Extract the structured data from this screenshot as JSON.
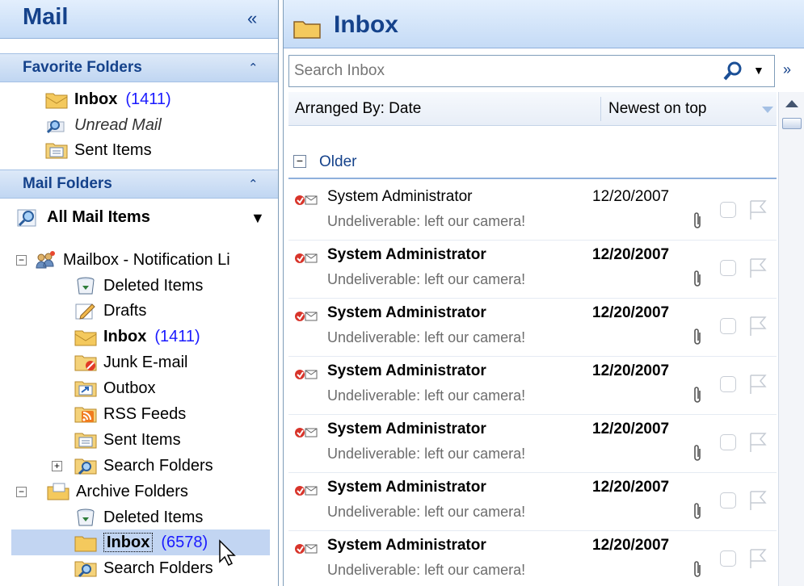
{
  "nav": {
    "title": "Mail",
    "collapse_glyph": "«",
    "favorites": {
      "header": "Favorite Folders",
      "collapse_glyph": "⌃",
      "items": [
        {
          "label": "Inbox",
          "count": "(1411)",
          "icon": "inbox-folder-icon"
        },
        {
          "label": "Unread Mail",
          "icon": "search-folder-icon"
        },
        {
          "label": "Sent Items",
          "icon": "sent-items-icon"
        }
      ]
    },
    "mail_folders": {
      "header": "Mail Folders",
      "collapse_glyph": "⌃",
      "all_items_label": "All Mail Items",
      "all_items_arrow": "▼",
      "mailbox": {
        "label": "Mailbox - Notification Li",
        "expander": "−",
        "children": [
          {
            "label": "Deleted Items",
            "icon": "deleted-items-icon"
          },
          {
            "label": "Drafts",
            "icon": "drafts-icon"
          },
          {
            "label": "Inbox",
            "count": "(1411)",
            "icon": "inbox-folder-icon"
          },
          {
            "label": "Junk E-mail",
            "icon": "junk-email-icon"
          },
          {
            "label": "Outbox",
            "icon": "outbox-icon"
          },
          {
            "label": "RSS Feeds",
            "icon": "rss-feeds-icon"
          },
          {
            "label": "Sent Items",
            "icon": "sent-items-icon"
          },
          {
            "label": "Search Folders",
            "icon": "search-folder-icon",
            "expander": "+"
          }
        ]
      },
      "archive": {
        "label": "Archive Folders",
        "expander": "−",
        "children": [
          {
            "label": "Deleted Items",
            "icon": "deleted-items-icon"
          },
          {
            "label": "Inbox",
            "count": "(6578)",
            "icon": "inbox-folder-icon",
            "selected": true
          },
          {
            "label": "Search Folders",
            "icon": "search-folder-icon"
          }
        ]
      }
    }
  },
  "main": {
    "title": "Inbox",
    "search_placeholder": "Search Inbox",
    "search_dropdown": "▼",
    "expand_glyph": "»",
    "arranged_by": "Arranged By: Date",
    "sort_order": "Newest on top",
    "group_expander": "−",
    "group_label": "Older",
    "messages": [
      {
        "from": "System Administrator",
        "date": "12/20/2007",
        "subject": "Undeliverable: left our camera!",
        "unread": false
      },
      {
        "from": "System Administrator",
        "date": "12/20/2007",
        "subject": "Undeliverable: left our camera!",
        "unread": true
      },
      {
        "from": "System Administrator",
        "date": "12/20/2007",
        "subject": "Undeliverable: left our camera!",
        "unread": true
      },
      {
        "from": "System Administrator",
        "date": "12/20/2007",
        "subject": "Undeliverable: left our camera!",
        "unread": true
      },
      {
        "from": "System Administrator",
        "date": "12/20/2007",
        "subject": "Undeliverable: left our camera!",
        "unread": true
      },
      {
        "from": "System Administrator",
        "date": "12/20/2007",
        "subject": "Undeliverable: left our camera!",
        "unread": true
      },
      {
        "from": "System Administrator",
        "date": "12/20/2007",
        "subject": "Undeliverable: left our camera!",
        "unread": true
      }
    ]
  },
  "colors": {
    "header_text": "#15428b",
    "count_text": "#1a1aff",
    "selection": "#c2d5f2",
    "subject_text": "#6d6d6d"
  }
}
